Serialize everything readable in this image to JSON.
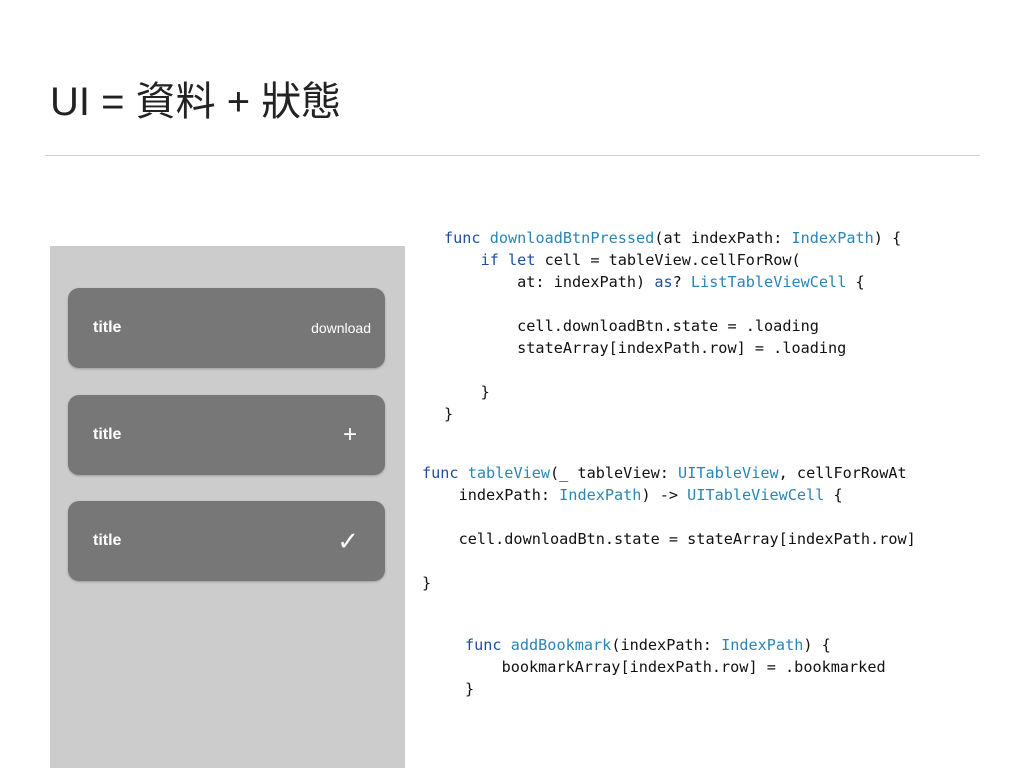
{
  "slide": {
    "title": "UI = 資料 + 狀態"
  },
  "list": {
    "cells": [
      {
        "title": "title",
        "action": "download"
      },
      {
        "title": "title",
        "action": "+"
      },
      {
        "title": "title",
        "action": "✓"
      }
    ]
  },
  "code": {
    "block1": [
      "func downloadBtnPressed(at indexPath: IndexPath) {",
      "    if let cell = tableView.cellForRow(",
      "        at: indexPath) as? ListTableViewCell {",
      "",
      "        cell.downloadBtn.state = .loading",
      "        stateArray[indexPath.row] = .loading",
      "",
      "    }",
      "}"
    ],
    "block2": [
      "func tableView(_ tableView: UITableView, cellForRowAt",
      "    indexPath: IndexPath) -> UITableViewCell {",
      "",
      "    cell.downloadBtn.state = stateArray[indexPath.row]",
      "",
      "}"
    ],
    "block3": [
      "func addBookmark(indexPath: IndexPath) {",
      "    bookmarkArray[indexPath.row] = .bookmarked",
      "}"
    ]
  },
  "colors": {
    "keyword": "#1f4ea3",
    "type": "#2a85b8",
    "cell_background": "#777777",
    "list_background": "#cccccc"
  }
}
